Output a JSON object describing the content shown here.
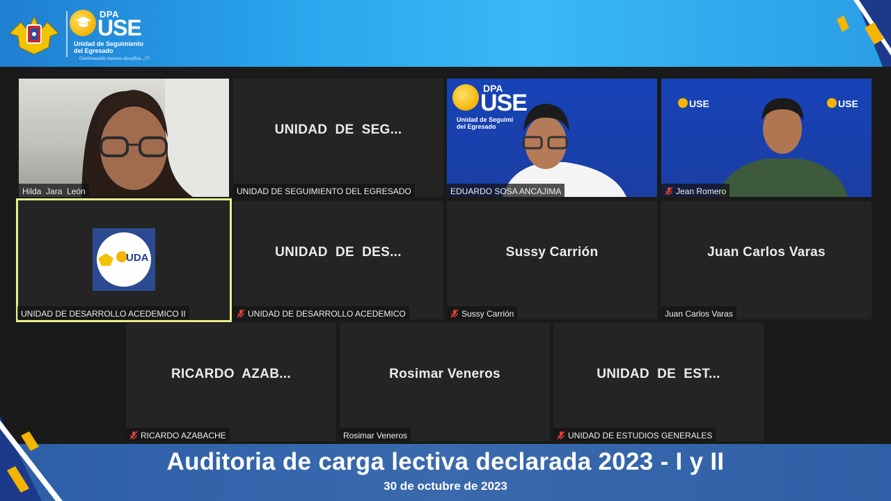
{
  "header": {
    "logo_dpa": "DPA",
    "logo_use": "USE",
    "logo_subtitle_line1": "Unidad de Seguimiento",
    "logo_subtitle_line2": "del Egresado",
    "logo_tagline": "Gestionando nuevos desafíos...!!!"
  },
  "participants": [
    {
      "display": "",
      "label": "Hilda  Jara  León",
      "muted": false,
      "video": true
    },
    {
      "display": "UNIDAD  DE  SEG...",
      "label": "UNIDAD DE SEGUIMIENTO DEL EGRESADO",
      "muted": false,
      "video": false
    },
    {
      "display": "",
      "label": "EDUARDO SOSA ANCAJIMA",
      "muted": false,
      "video": true,
      "bg_text_dpa": "DPA",
      "bg_text_use": "USE",
      "bg_text_sub": "Unidad de Seguimi",
      "bg_text_sub2": "del Egresado"
    },
    {
      "display": "",
      "label": "Jean Romero",
      "muted": true,
      "video": true,
      "bg_text_use": "USE"
    },
    {
      "display": "",
      "label": "UNIDAD DE DESARROLLO ACEDEMICO II",
      "muted": false,
      "video": false,
      "logo_text": "UDA",
      "active_speaker": true
    },
    {
      "display": "UNIDAD  DE  DES...",
      "label": "UNIDAD DE DESARROLLO ACEDEMICO",
      "muted": true,
      "video": false
    },
    {
      "display": "Sussy Carrión",
      "label": "Sussy Carrión",
      "muted": true,
      "video": false
    },
    {
      "display": "Juan Carlos Varas",
      "label": "Juan Carlos Varas",
      "muted": false,
      "video": false
    },
    {
      "display": "RICARDO  AZAB...",
      "label": "RICARDO AZABACHE",
      "muted": true,
      "video": false
    },
    {
      "display": "Rosimar Veneros",
      "label": "Rosimar Veneros",
      "muted": false,
      "video": false
    },
    {
      "display": "UNIDAD  DE  EST...",
      "label": "UNIDAD DE ESTUDIOS GENERALES",
      "muted": true,
      "video": false
    }
  ],
  "footer": {
    "title": "Auditoria de carga lectiva declarada 2023 - I y II",
    "date": "30 de octubre de 2023"
  },
  "colors": {
    "header_blue": "#2aa7ee",
    "footer_blue": "#3a69ad",
    "tile_bg": "#242424",
    "active_outline": "#e8ef8a",
    "muted_red": "#e0413a",
    "accent_yellow": "#f5b400"
  }
}
